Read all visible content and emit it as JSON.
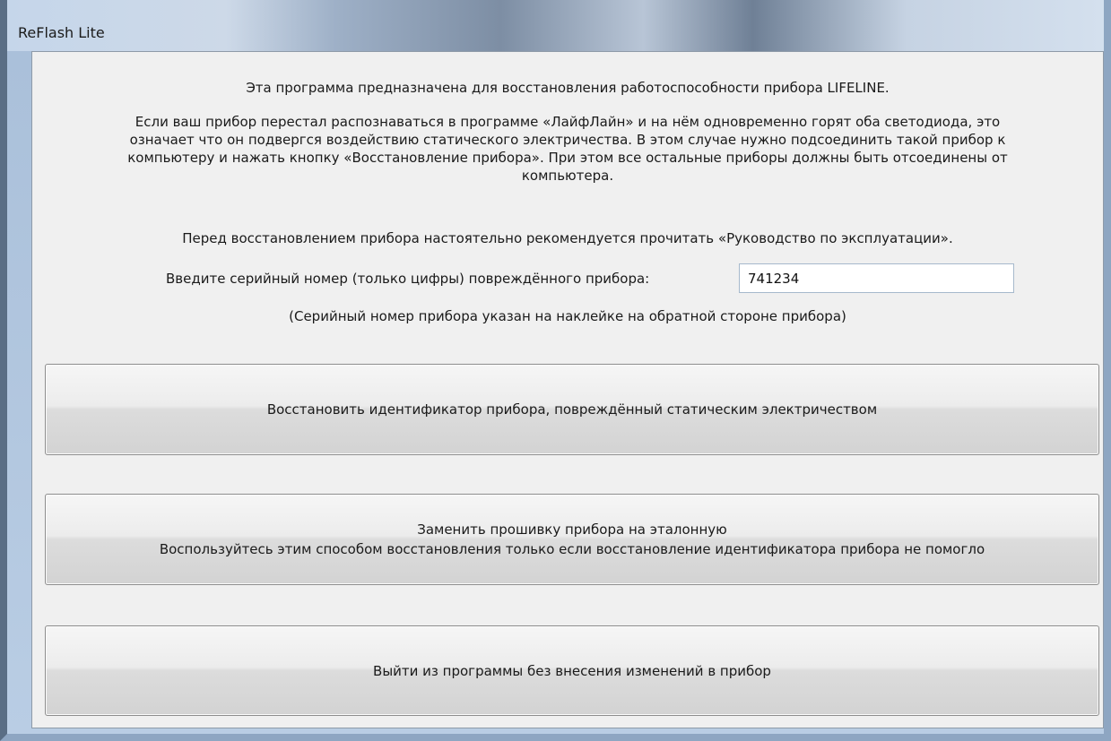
{
  "window": {
    "title": "ReFlash Lite"
  },
  "content": {
    "intro": "Эта программа предназначена для восстановления работоспособности прибора LIFELINE.",
    "description_lines": [
      "Если ваш прибор перестал распознаваться в программе «ЛайфЛайн» и на нём одновременно горят оба светодиода, это",
      "означает что он подвергся воздействию статического электричества. В этом случае нужно подсоединить такой прибор к",
      "компьютеру и нажать кнопку «Восстановление прибора». При этом все остальные приборы должны быть отсоединены от",
      "компьютера."
    ],
    "recommendation": "Перед восстановлением прибора настоятельно рекомендуется прочитать «Руководство по эксплуатации».",
    "serial_label": "Введите серийный номер (только цифры) повреждённого прибора:",
    "serial_value": "741234",
    "serial_hint": "(Серийный номер прибора указан на наклейке на обратной стороне прибора)"
  },
  "buttons": {
    "restore_id": "Восстановить идентификатор прибора, повреждённый статическим электричеством",
    "replace_firmware_line1": "Заменить прошивку прибора на эталонную",
    "replace_firmware_line2": "Воспользуйтесь этим способом восстановления только если восстановление идентификатора прибора не помогло",
    "exit": "Выйти из программы без внесения изменений в прибор"
  }
}
